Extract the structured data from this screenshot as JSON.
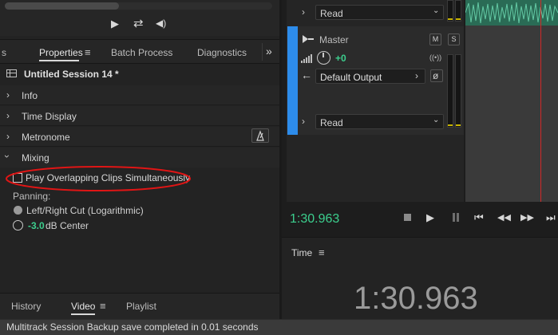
{
  "top_controls": {
    "play_icon": "▶",
    "loop_icon": "⇄",
    "output_icon": "◀)"
  },
  "tabs": {
    "truncated": "s",
    "properties": "Properties",
    "menu_icon": "≡",
    "batch": "Batch Process",
    "diagnostics": "Diagnostics",
    "overflow": "»"
  },
  "session": {
    "title": "Untitled Session 14 *"
  },
  "sections": {
    "info": "Info",
    "time_display": "Time Display",
    "metronome": "Metronome",
    "mixing": "Mixing"
  },
  "mixing": {
    "checkbox_label": "Play Overlapping Clips Simultaneously",
    "checkbox_checked": false,
    "panning_label": "Panning:",
    "option1": "Left/Right Cut (Logarithmic)",
    "option2_value": "-3.0",
    "option2_suffix": "dB Center"
  },
  "bottom_tabs": {
    "history": "History",
    "video": "Video",
    "menu_icon": "≡",
    "playlist": "Playlist"
  },
  "status": {
    "message": "Multitrack Session Backup save completed in 0.01 seconds"
  },
  "mixer": {
    "read_top": "Read",
    "master_label": "Master",
    "mute": "M",
    "solo": "S",
    "volume": "+0",
    "output": "Default Output",
    "read_bottom": "Read"
  },
  "transport": {
    "time": "1:30.963"
  },
  "time_panel": {
    "title": "Time",
    "menu_icon": "≡",
    "display": "1:30.963"
  },
  "colors": {
    "accent_blue": "#2d8ceb",
    "green_time": "#3ccf8e",
    "annotation_red": "#e01515",
    "playhead": "#d22828"
  }
}
